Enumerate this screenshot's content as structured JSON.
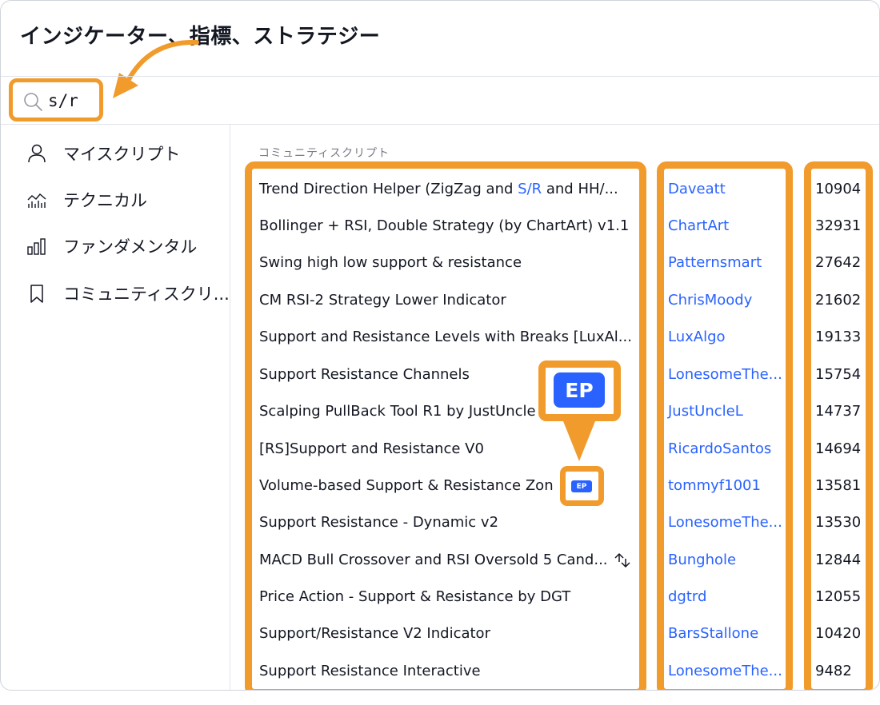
{
  "header": {
    "title": "インジケーター、指標、ストラテジー"
  },
  "search": {
    "value": "s/r",
    "icon": "search-icon"
  },
  "sidebar": {
    "items": [
      {
        "label": "マイスクリプト",
        "icon": "user-icon"
      },
      {
        "label": "テクニカル",
        "icon": "technicals-chart-icon"
      },
      {
        "label": "ファンダメンタル",
        "icon": "bar-chart-icon"
      },
      {
        "label": "コミュニティスクリ...",
        "icon": "bookmark-icon"
      }
    ]
  },
  "section": {
    "label": "コミュニティスクリプト"
  },
  "scripts": [
    {
      "name_before": "Trend Direction Helper (ZigZag and ",
      "name_match": "S/R",
      "name_after": " and HH/...",
      "author": "Daveatt",
      "count": "10904"
    },
    {
      "name": "Bollinger + RSI, Double Strategy (by ChartArt) v1.1",
      "author": "ChartArt",
      "count": "32931"
    },
    {
      "name": "Swing high low support & resistance",
      "author": "Patternsmart",
      "count": "27642"
    },
    {
      "name": "CM RSI-2 Strategy Lower Indicator",
      "author": "ChrisMoody",
      "count": "21602"
    },
    {
      "name": "Support and Resistance Levels with Breaks [LuxAl...",
      "author": "LuxAlgo",
      "count": "19133"
    },
    {
      "name": "Support Resistance Channels",
      "author": "LonesomeThe...",
      "count": "15754"
    },
    {
      "name": "Scalping PullBack Tool R1 by JustUncle",
      "author": "JustUncleL",
      "count": "14737"
    },
    {
      "name": "[RS]Support and Resistance V0",
      "author": "RicardoSantos",
      "count": "14694"
    },
    {
      "name": "Volume-based Support & Resistance Zon",
      "author": "tommyf1001",
      "count": "13581"
    },
    {
      "name": "Support Resistance - Dynamic v2",
      "author": "LonesomeThe...",
      "count": "13530"
    },
    {
      "name": "MACD Bull Crossover and RSI Oversold 5 Cand...",
      "author": "Bunghole",
      "count": "12844"
    },
    {
      "name": "Price Action - Support & Resistance by DGT",
      "author": "dgtrd",
      "count": "12055"
    },
    {
      "name": "Support/Resistance V2 Indicator",
      "author": "BarsStallone",
      "count": "10420"
    },
    {
      "name": "Support Resistance Interactive",
      "author": "LonesomeThe...",
      "count": "9482"
    }
  ],
  "badges": {
    "ep": "EP"
  },
  "colors": {
    "accent": "#2962ff",
    "highlight": "#f19b2c",
    "text": "#131722",
    "muted": "#787b86"
  }
}
